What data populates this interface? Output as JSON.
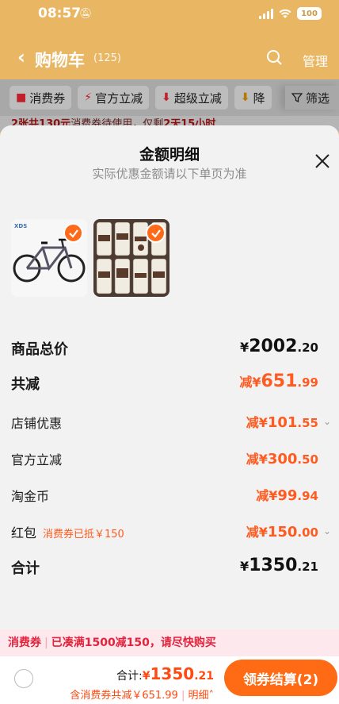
{
  "status_bar": {
    "time": "08:57",
    "battery": "100"
  },
  "header": {
    "title": "购物车",
    "count": "(125)",
    "manage_label": "管理"
  },
  "filters": [
    {
      "label": "消费券",
      "icon": "ticket-icon"
    },
    {
      "label": "官方立减",
      "icon": "bolt-icon"
    },
    {
      "label": "超级立减",
      "icon": "arrow-down-icon"
    },
    {
      "label": "降",
      "icon": "arrow-down-icon"
    }
  ],
  "filter_button_label": "筛选",
  "coupon_banner": {
    "prefix": "2张共130元",
    "middle": "消费券待使用，仅剩",
    "time": "2天15小时"
  },
  "sheet": {
    "title": "金额明细",
    "subtitle": "实际优惠金额请以下单页为准",
    "products": [
      {
        "name": "bicycle",
        "selected": true
      },
      {
        "name": "socks-set",
        "selected": true
      }
    ],
    "rows": [
      {
        "label": "商品总价",
        "cur": "¥",
        "int": "2002",
        "dec": ".20"
      },
      {
        "label": "共减",
        "prefix": "减¥",
        "int": "651",
        "dec": ".99"
      },
      {
        "label": "店铺优惠",
        "prefix": "减¥",
        "int": "101",
        "dec": ".55"
      },
      {
        "label": "官方立减",
        "prefix": "减¥",
        "int": "300",
        "dec": ".50"
      },
      {
        "label": "淘金币",
        "prefix": "减¥",
        "int": "99",
        "dec": ".94"
      },
      {
        "label": "红包",
        "note": "消费券已抵￥150",
        "prefix": "减¥",
        "int": "150",
        "dec": ".00"
      },
      {
        "label": "合计",
        "cur": "¥",
        "int": "1350",
        "dec": ".21"
      }
    ]
  },
  "promo_bar": {
    "tag": "消费券",
    "text": "已凑满1500减150，请尽快购买"
  },
  "bottom_bar": {
    "total_label": "合计:",
    "total_cur": "¥",
    "total_int": "1350",
    "total_dec": ".21",
    "discount_text": "含消费券共减￥651.99",
    "detail_label": "明细",
    "checkout_label": "领券结算(2)"
  },
  "colors": {
    "accent": "#ff5a1f",
    "header_bg": "#e9b763",
    "checkout": "#ff6a14"
  }
}
